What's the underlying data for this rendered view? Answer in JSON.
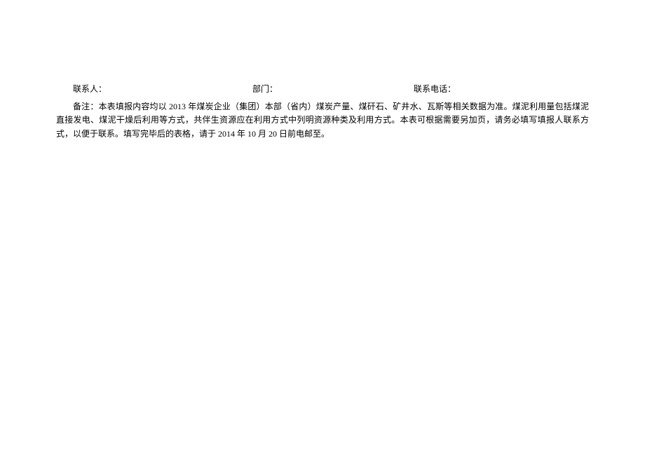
{
  "contact": {
    "person_label": "联系人：",
    "department_label": "部门：",
    "phone_label": "联系电话："
  },
  "note": {
    "text": "备注：本表填报内容均以 2013 年煤炭企业（集团）本部（省内）煤炭产量、煤矸石、矿井水、瓦斯等相关数据为准。煤泥利用量包括煤泥直接发电、煤泥干燥后利用等方式，共伴生资源应在利用方式中列明资源种类及利用方式。本表可根据需要另加页，请务必填写填报人联系方式，以便于联系。填写完毕后的表格，请于 2014 年 10 月 20 日前电邮至。"
  }
}
